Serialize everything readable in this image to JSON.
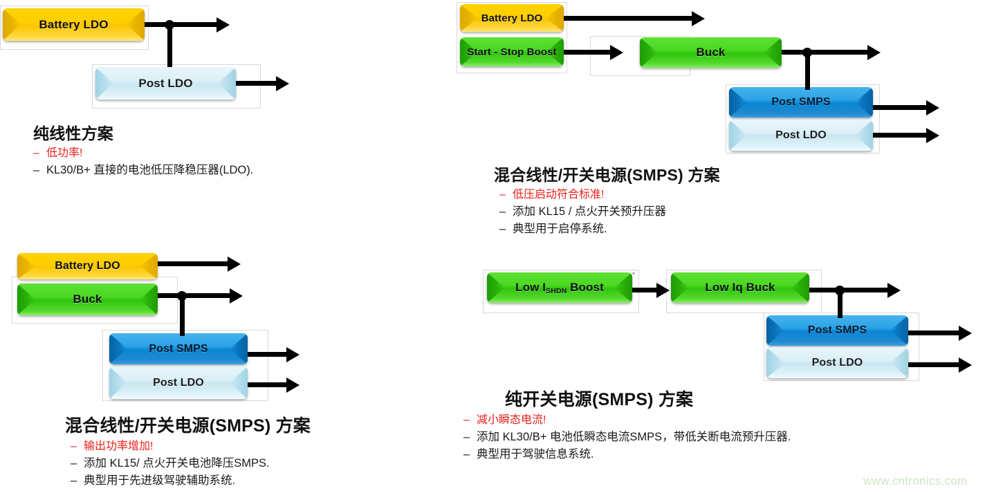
{
  "meta": {
    "watermark": "www.cntronics.com"
  },
  "panels": [
    {
      "id": "pure-linear",
      "blocks": [
        {
          "name": "battery-ldo",
          "label": "Battery LDO",
          "color": "yellow"
        },
        {
          "name": "post-ldo",
          "label": "Post LDO",
          "color": "pale"
        }
      ],
      "caption": {
        "title": "纯线性方案",
        "bullets": [
          {
            "text": "低功率!",
            "highlight": true
          },
          {
            "text": "KL30/B+ 直接的电池低压降稳压器(LDO).",
            "highlight": false
          }
        ]
      }
    },
    {
      "id": "hybrid-linear-smps-top",
      "blocks": [
        {
          "name": "battery-ldo",
          "label": "Battery LDO",
          "color": "yellow"
        },
        {
          "name": "start-stop-boost",
          "label": "Start - Stop Boost",
          "color": "green"
        },
        {
          "name": "buck",
          "label": "Buck",
          "color": "green"
        },
        {
          "name": "post-smps",
          "label": "Post SMPS",
          "color": "blue"
        },
        {
          "name": "post-ldo",
          "label": "Post LDO",
          "color": "pale"
        }
      ],
      "caption": {
        "title": "混合线性/开关电源(SMPS) 方案",
        "bullets": [
          {
            "text": "低压启动符合标准!",
            "highlight": true
          },
          {
            "text": "添加 KL15 / 点火开关预升压器",
            "highlight": false
          },
          {
            "text": "典型用于启停系统.",
            "highlight": false
          }
        ]
      }
    },
    {
      "id": "hybrid-linear-smps-bottom",
      "blocks": [
        {
          "name": "battery-ldo",
          "label": "Battery LDO",
          "color": "yellow"
        },
        {
          "name": "buck",
          "label": "Buck",
          "color": "green"
        },
        {
          "name": "post-smps",
          "label": "Post SMPS",
          "color": "blue"
        },
        {
          "name": "post-ldo",
          "label": "Post LDO",
          "color": "pale"
        }
      ],
      "caption": {
        "title": "混合线性/开关电源(SMPS) 方案",
        "bullets": [
          {
            "text": "输出功率增加!",
            "highlight": true
          },
          {
            "text": "添加 KL15/ 点火开关电池降压SMPS.",
            "highlight": false
          },
          {
            "text": "典型用于先进级驾驶辅助系统.",
            "highlight": false
          }
        ]
      }
    },
    {
      "id": "pure-smps",
      "blocks": [
        {
          "name": "low-ishdn-boost",
          "label": "Low I",
          "label_sub": "SHDN",
          "label_tail": " Boost",
          "color": "green"
        },
        {
          "name": "low-iq-buck",
          "label": "Low Iq Buck",
          "color": "green"
        },
        {
          "name": "post-smps",
          "label": "Post SMPS",
          "color": "blue"
        },
        {
          "name": "post-ldo",
          "label": "Post LDO",
          "color": "pale"
        }
      ],
      "caption": {
        "title": "纯开关电源(SMPS) 方案",
        "bullets": [
          {
            "text": "减小瞬态电流!",
            "highlight": true
          },
          {
            "text": "添加 KL30/B+ 电池低瞬态电流SMPS，带低关断电流预升压器.",
            "highlight": false
          },
          {
            "text": "典型用于驾驶信息系统.",
            "highlight": false
          }
        ]
      }
    }
  ],
  "colors": {
    "yellow": "#ffcf00",
    "green": "#3ecf18",
    "blue": "#0f8fdc",
    "pale": "#d6ecf5",
    "highlight": "#e8201a",
    "wire": "#000000",
    "watermark": "#cde4c4"
  }
}
